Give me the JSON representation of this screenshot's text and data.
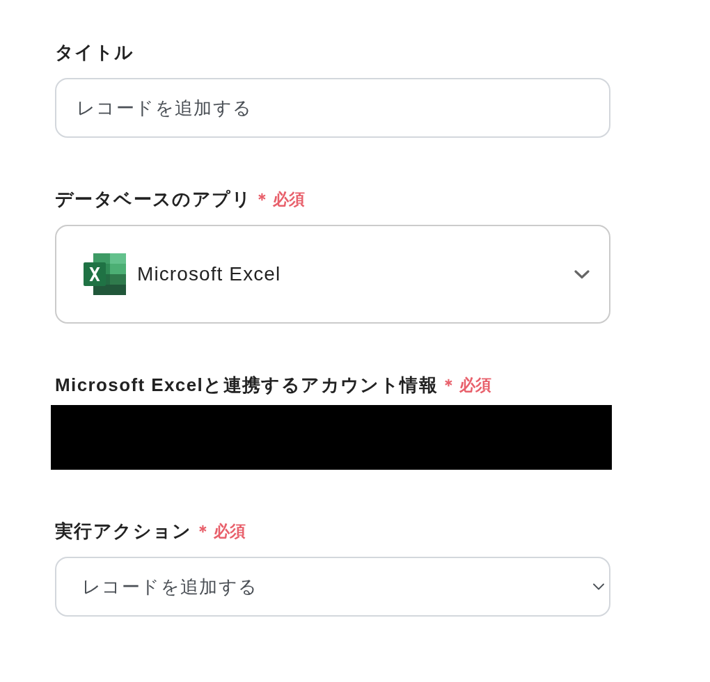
{
  "fields": [
    {
      "kind": "text_input",
      "label": "タイトル",
      "value": "レコードを追加する"
    },
    {
      "kind": "app_select",
      "label": "データベースのアプリ",
      "required_mark": "＊",
      "required_text": "必須",
      "value": "Microsoft Excel"
    },
    {
      "kind": "redacted",
      "label": "Microsoft Excelと連携するアカウント情報",
      "required_mark": "＊",
      "required_text": "必須"
    },
    {
      "kind": "select",
      "label": "実行アクション",
      "required_mark": "＊",
      "required_text": "必須",
      "value": "レコードを追加する"
    }
  ]
}
